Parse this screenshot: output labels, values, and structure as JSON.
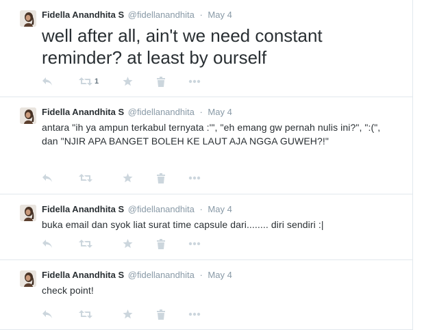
{
  "colors": {
    "text": "#292f33",
    "muted": "#8899a6",
    "icon": "#ccd6dd",
    "border": "#e1e8ed"
  },
  "icons": {
    "reply": "reply-icon",
    "retweet": "retweet-icon",
    "favorite": "star-icon",
    "delete": "trash-icon",
    "more": "more-icon"
  },
  "tweets": [
    {
      "fullname": "Fidella Anandhita S",
      "username": "@fidellanandhita",
      "separator": "·",
      "time": "May 4",
      "text": "well after all, ain't we need constant reminder? at least by ourself",
      "retweet_count": "1"
    },
    {
      "fullname": "Fidella Anandhita S",
      "username": "@fidellanandhita",
      "separator": "·",
      "time": "May 4",
      "text": "antara \"ih ya ampun terkabul ternyata :'\", \"eh emang gw pernah nulis ini?\", \":(\", dan \"NJIR APA BANGET BOLEH KE LAUT AJA NGGA GUWEH?!\"",
      "retweet_count": ""
    },
    {
      "fullname": "Fidella Anandhita S",
      "username": "@fidellanandhita",
      "separator": "·",
      "time": "May 4",
      "text": "buka email dan syok liat surat time capsule dari........ diri sendiri :|",
      "retweet_count": ""
    },
    {
      "fullname": "Fidella Anandhita S",
      "username": "@fidellanandhita",
      "separator": "·",
      "time": "May 4",
      "text": "check point!",
      "retweet_count": ""
    }
  ]
}
